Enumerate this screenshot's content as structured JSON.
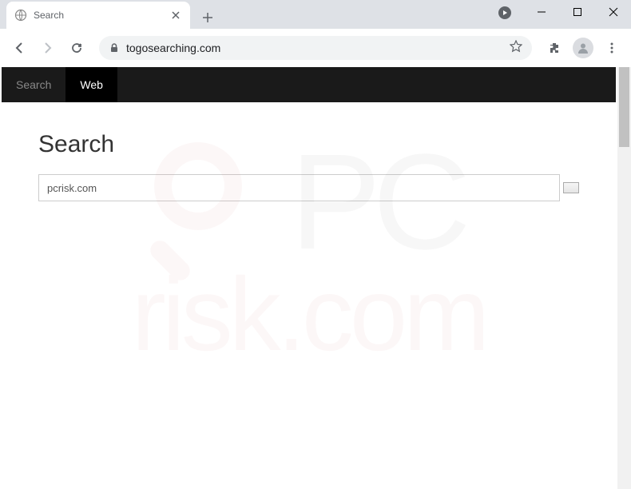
{
  "browser": {
    "tab": {
      "title": "Search"
    },
    "url": "togosearching.com"
  },
  "page": {
    "nav": {
      "item1": "Search",
      "item2": "Web"
    },
    "heading": "Search",
    "search_value": "pcrisk.com"
  },
  "watermark": {
    "line1": "PC",
    "line2": "risk.com"
  }
}
